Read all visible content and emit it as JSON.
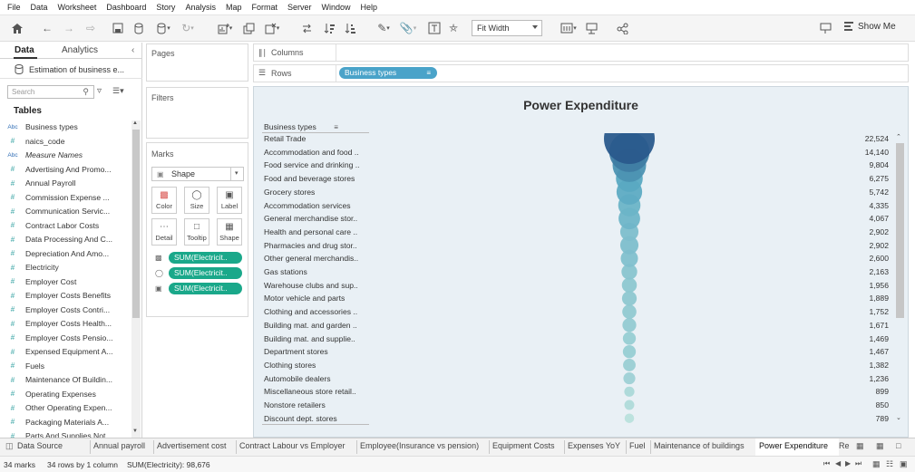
{
  "menu": [
    "File",
    "Data",
    "Worksheet",
    "Dashboard",
    "Story",
    "Analysis",
    "Map",
    "Format",
    "Server",
    "Window",
    "Help"
  ],
  "toolbar": {
    "fit_value": "Fit Width",
    "show_me": "Show Me"
  },
  "left_panel": {
    "tab_data": "Data",
    "tab_analytics": "Analytics",
    "datasource": "Estimation of business e...",
    "search_placeholder": "Search",
    "tables_heading": "Tables",
    "fields": [
      {
        "type": "abc",
        "name": "Business types"
      },
      {
        "type": "#",
        "name": "naics_code"
      },
      {
        "type": "abc",
        "name": "Measure Names"
      },
      {
        "type": "#",
        "name": "Advertising And Promo..."
      },
      {
        "type": "#",
        "name": "Annual Payroll"
      },
      {
        "type": "#",
        "name": "Commission Expense ..."
      },
      {
        "type": "#",
        "name": "Communication Servic..."
      },
      {
        "type": "#",
        "name": "Contract Labor Costs"
      },
      {
        "type": "#",
        "name": "Data Processing And C..."
      },
      {
        "type": "#",
        "name": "Depreciation And Amo..."
      },
      {
        "type": "#",
        "name": "Electricity"
      },
      {
        "type": "#",
        "name": "Employer Cost"
      },
      {
        "type": "#",
        "name": "Employer Costs Benefits"
      },
      {
        "type": "#",
        "name": "Employer Costs Contri..."
      },
      {
        "type": "#",
        "name": "Employer Costs Health..."
      },
      {
        "type": "#",
        "name": "Employer Costs Pensio..."
      },
      {
        "type": "#",
        "name": "Expensed Equipment A..."
      },
      {
        "type": "#",
        "name": "Fuels"
      },
      {
        "type": "#",
        "name": "Maintenance Of Buildin..."
      },
      {
        "type": "#",
        "name": "Operating Expenses"
      },
      {
        "type": "#",
        "name": "Other Operating Expen..."
      },
      {
        "type": "#",
        "name": "Packaging Materials A..."
      },
      {
        "type": "#",
        "name": "Parts And Supplies Not..."
      }
    ]
  },
  "shelves": {
    "pages": "Pages",
    "filters": "Filters",
    "columns": "Columns",
    "rows": "Rows",
    "rows_pill": "Business types"
  },
  "marks": {
    "title": "Marks",
    "type": "Shape",
    "buttons": [
      "Color",
      "Size",
      "Label",
      "Detail",
      "Tooltip",
      "Shape"
    ],
    "pills": [
      "SUM(Electricit..",
      "SUM(Electricit..",
      "SUM(Electricit.."
    ]
  },
  "viz": {
    "title": "Power Expenditure",
    "column_header": "Business types",
    "colors": {
      "max": "#2a5a8c",
      "mid": "#5aa9c2",
      "min": "#b9e0dc"
    }
  },
  "chart_data": {
    "type": "scatter",
    "title": "Power Expenditure",
    "measure": "SUM(Electricity)",
    "categories": [
      "Retail Trade",
      "Accommodation and food ..",
      "Food service and drinking ..",
      "Food and beverage stores",
      "Grocery stores",
      "Accommodation services",
      "General merchandise stor..",
      "Health and personal care ..",
      "Pharmacies and drug stor..",
      "Other general merchandis..",
      "Gas stations",
      "Warehouse clubs and sup..",
      "Motor vehicle and parts",
      "Clothing and accessories ..",
      "Building mat. and garden ..",
      "Building mat. and supplie..",
      "Department stores",
      "Clothing stores",
      "Automobile dealers",
      "Miscellaneous store retail..",
      "Nonstore retailers",
      "Discount dept. stores"
    ],
    "values": [
      22524,
      14140,
      9804,
      6275,
      5742,
      4335,
      4067,
      2902,
      2902,
      2600,
      2163,
      1956,
      1889,
      1752,
      1671,
      1469,
      1467,
      1382,
      1236,
      899,
      850,
      789
    ],
    "value_labels": [
      "22,524",
      "14,140",
      "9,804",
      "6,275",
      "5,742",
      "4,335",
      "4,067",
      "2,902",
      "2,902",
      "2,600",
      "2,163",
      "1,956",
      "1,889",
      "1,752",
      "1,671",
      "1,469",
      "1,467",
      "1,382",
      "1,236",
      "899",
      "850",
      "789"
    ]
  },
  "bottom_tabs": [
    "Data Source",
    "Annual payroll",
    "Advertisement cost",
    "Contract Labour vs Employer",
    "Employee(Insurance vs pension)",
    "Equipment Costs",
    "Expenses YoY",
    "Fuel",
    "Maintenance of buildings",
    "Power Expenditure",
    "Re"
  ],
  "active_tab": "Power Expenditure",
  "status": {
    "marks": "34 marks",
    "rows": "34 rows by 1 column",
    "sum": "SUM(Electricity): 98,676"
  }
}
